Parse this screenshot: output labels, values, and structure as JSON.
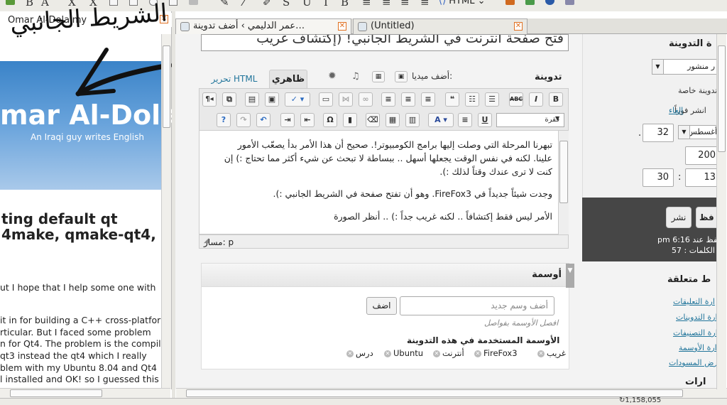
{
  "toolbar": {
    "format_select": "HTML",
    "glyphs": [
      "A",
      "X²",
      "X₂",
      "I",
      "B",
      "U",
      "S"
    ]
  },
  "sidebar": {
    "header_title": "Omar Al-Dolaimy",
    "handwriting": "الشريط الجانبي",
    "blog_title": "mar Al-Dolai",
    "blog_subtitle": "An Iraqi guy writes English",
    "post_title_lines": [
      "ting default qt",
      "4make, qmake-qt4,"
    ],
    "post_lines": [
      "ut I hope that I help some one with",
      "it in for building a C++ cross-platfor",
      "rticular. But I faced some problem",
      "n for Qt4. The problem is the compile",
      " qt3 instead the qt4 which I really",
      "blem with my Ubuntu 8.04 and Qt4",
      "l installed and OK! so I guessed this"
    ]
  },
  "tabs": [
    {
      "label": "عمر الدليمي › أضف تدوينة…",
      "active": true
    },
    {
      "label": "(Untitled)",
      "active": false
    }
  ],
  "editor": {
    "post_title": "فتح صفحة انترنت في الشريط الجانبي! (إكتشاف غريب",
    "post_label": "تدوينة",
    "add_media": "أضف ميديا:",
    "tab_visual": "ظاهري",
    "tab_html": "تحرير HTML",
    "format_block": "فقرة",
    "paragraphs": [
      "تبهرنا المرحلة التي وصلت إليها برامج الكومبيوتر!. صحيح أن هذا الأمر بدأ يصعّب الأمور",
      "علينا. لكنه في نفس الوقت يجعلها أسهل .. ببساطة لا تبحث عن شيء أكثر مما تحتاج :) إن",
      "كنت لا ترى عندك وقتاً لذلك :).",
      "وجدت شيئاً جديداً في FireFox3. وهو أن تفتح صفحة في الشريط الجانبي :).",
      "الأمر ليس فقط إكتشافاً .. لكنه غريب جداً :) .. أنظر الصورة"
    ],
    "path_label": "مسار: p"
  },
  "tags": {
    "heading": "أوسمة",
    "input_placeholder": "أضف وسم جديد",
    "add_button": "اضف",
    "hint": "افصل الأوسمة بفواصل",
    "used_heading": "الأوسمة المستخدمة في هذه التدوينة",
    "items": [
      "غريب",
      "FireFox3",
      "أنترنت",
      "Ubuntu",
      "درس"
    ]
  },
  "publish": {
    "heading": "ة التدوينة",
    "status_select": "ر منشور",
    "private_label": "تدوينة خاصة",
    "publish_now": "انشر فوراً",
    "cancel": "إلغاء",
    "month": "أغسطس",
    "day": "32",
    "year": "200",
    "hour": "13",
    "minute": "30",
    "time_sep": ":",
    "dot": ".",
    "save_button": "فظ",
    "publish_button": "نشر",
    "saved_at": "pm 6:16 حفظ عند",
    "word_count": "الكلمات : 57"
  },
  "related": {
    "heading": "ط متعلقة",
    "links": [
      "ارة التعليقات",
      "ارة التدوينات",
      "ارة التصنيفات",
      "ارة الأوسمة",
      "رض المسودات"
    ]
  },
  "misc_heading": "ارات",
  "status_text": "↻1,158,055"
}
